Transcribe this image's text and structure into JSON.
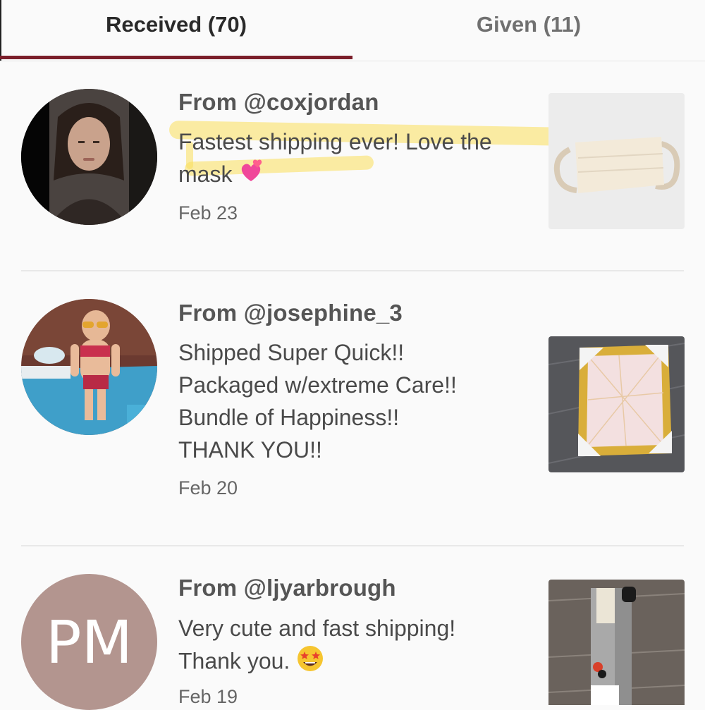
{
  "tabs": {
    "received": "Received (70)",
    "given": "Given (11)"
  },
  "reviews": [
    {
      "from": "From @coxjordan",
      "comment": "Fastest shipping ever! Love the mask",
      "emoji": "sparkling-heart-icon",
      "date": "Feb 23"
    },
    {
      "from": "From @josephine_3",
      "comment_lines": [
        "Shipped Super Quick!!",
        "Packaged w/extreme Care!!",
        "Bundle of Happiness!!",
        "THANK YOU!!"
      ],
      "date": "Feb 20"
    },
    {
      "from": "From @ljyarbrough",
      "comment_lines": [
        "Very cute and fast shipping!",
        "Thank you."
      ],
      "emoji": "star-struck-icon",
      "avatar_initials": "PM",
      "date": "Feb 19"
    }
  ],
  "colors": {
    "accent": "#7b1f2b",
    "pm_avatar": "#b3958f",
    "highlight": "#fade5a"
  }
}
